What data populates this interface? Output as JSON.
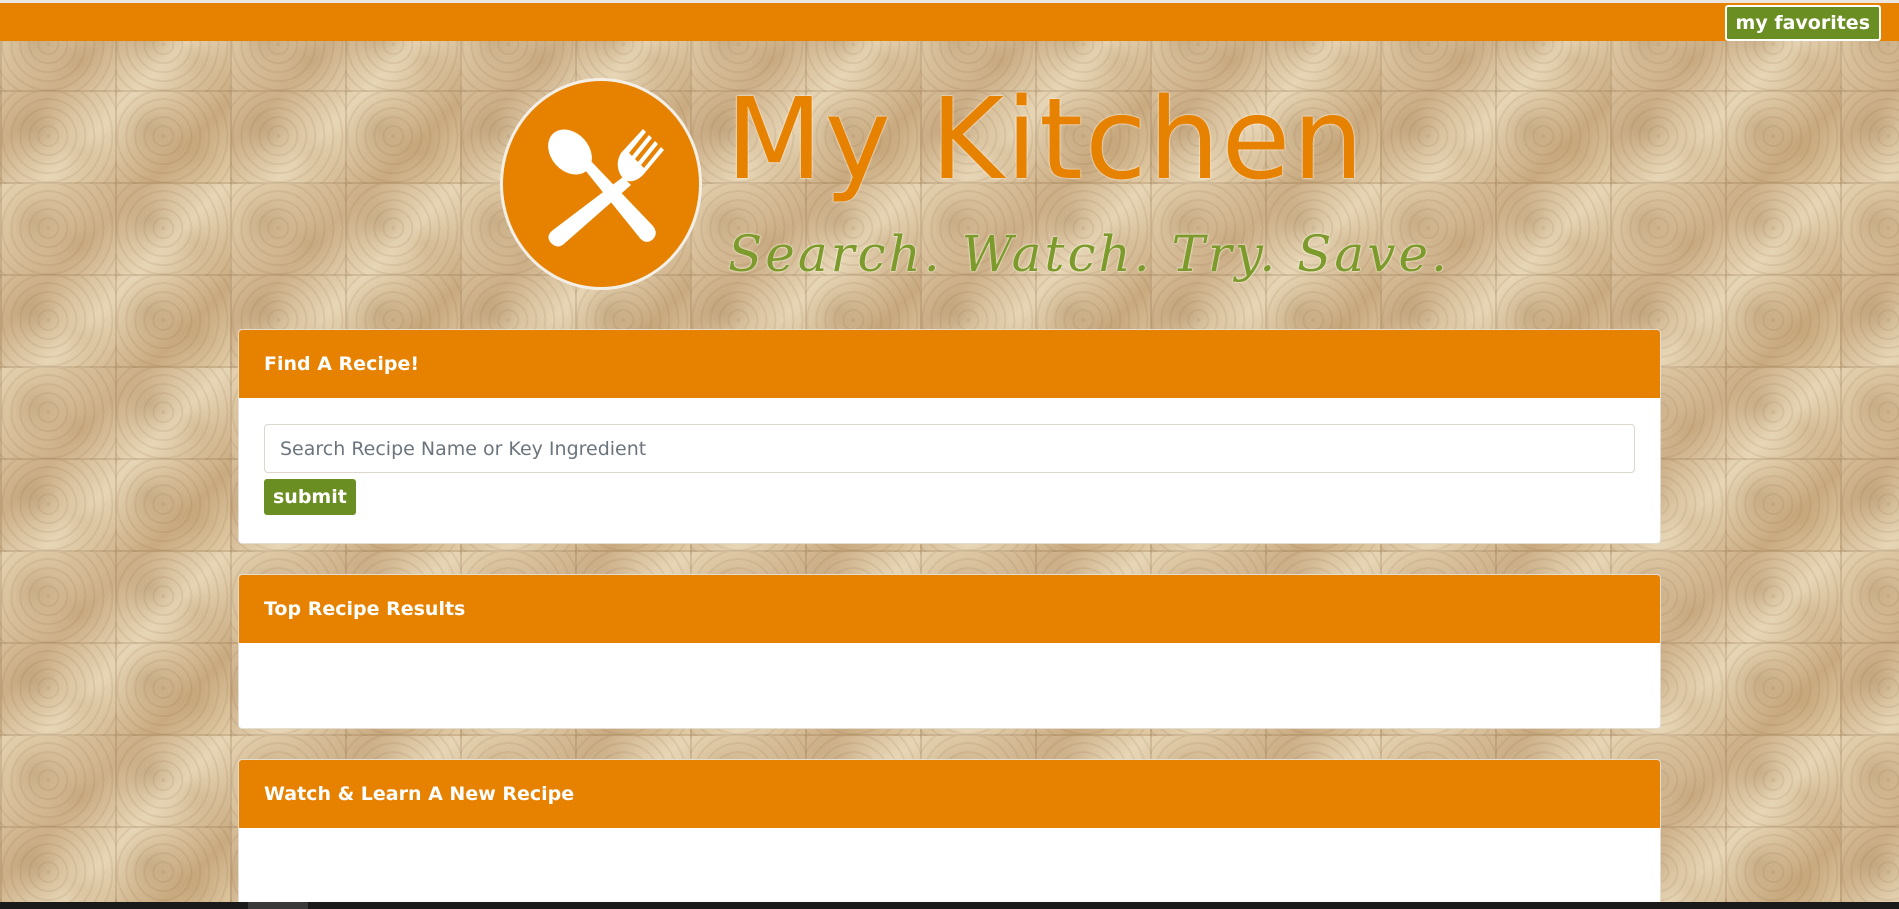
{
  "topbar": {
    "favorites_label": "my favorites"
  },
  "brand": {
    "logo_icon": "spoon-and-fork-icon",
    "title": "My Kitchen",
    "tagline": "Search. Watch. Try. Save."
  },
  "search_panel": {
    "heading": "Find A Recipe!",
    "input_placeholder": "Search Recipe Name or Key Ingredient",
    "input_value": "",
    "submit_label": "submit"
  },
  "results_panel": {
    "heading": "Top Recipe Results"
  },
  "watch_panel": {
    "heading": "Watch & Learn A New Recipe"
  },
  "colors": {
    "accent_orange": "#e78100",
    "button_green": "#6b8e23",
    "tagline_green": "#7d9a2c",
    "panel_white": "#ffffff"
  }
}
